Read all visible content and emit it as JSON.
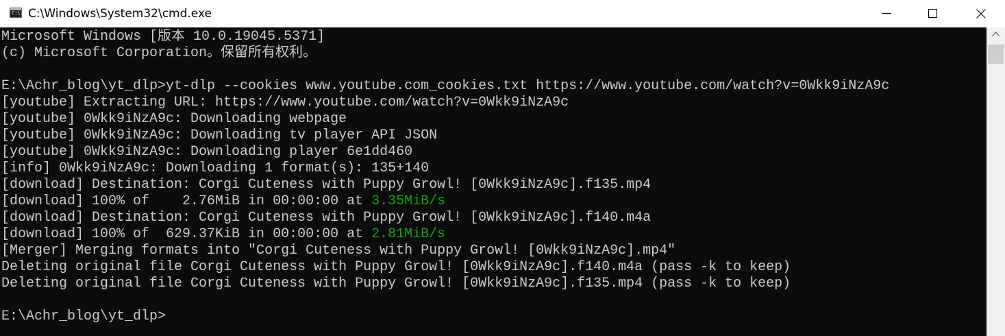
{
  "window": {
    "title": "C:\\Windows\\System32\\cmd.exe",
    "icon": "cmd-icon",
    "icon_glyph": "C:\\."
  },
  "controls": {
    "minimize": "minimize-icon",
    "maximize": "maximize-icon",
    "close": "close-icon"
  },
  "console": {
    "lines": [
      {
        "text": "Microsoft Windows [版本 10.0.19045.5371]"
      },
      {
        "text": "(c) Microsoft Corporation。保留所有权利。"
      },
      {
        "text": ""
      },
      {
        "text": "E:\\Achr_blog\\yt_dlp>yt-dlp --cookies www.youtube.com_cookies.txt https://www.youtube.com/watch?v=0Wkk9iNzA9c"
      },
      {
        "text": "[youtube] Extracting URL: https://www.youtube.com/watch?v=0Wkk9iNzA9c"
      },
      {
        "text": "[youtube] 0Wkk9iNzA9c: Downloading webpage"
      },
      {
        "text": "[youtube] 0Wkk9iNzA9c: Downloading tv player API JSON"
      },
      {
        "text": "[youtube] 0Wkk9iNzA9c: Downloading player 6e1dd460"
      },
      {
        "text": "[info] 0Wkk9iNzA9c: Downloading 1 format(s): 135+140"
      },
      {
        "text": "[download] Destination: Corgi Cuteness with Puppy Growl! [0Wkk9iNzA9c].f135.mp4"
      },
      {
        "text": "[download] 100% of    2.76MiB in 00:00:00 at ",
        "speed": "3.35MiB/s"
      },
      {
        "text": "[download] Destination: Corgi Cuteness with Puppy Growl! [0Wkk9iNzA9c].f140.m4a"
      },
      {
        "text": "[download] 100% of  629.37KiB in 00:00:00 at ",
        "speed": "2.81MiB/s"
      },
      {
        "text": "[Merger] Merging formats into \"Corgi Cuteness with Puppy Growl! [0Wkk9iNzA9c].mp4\""
      },
      {
        "text": "Deleting original file Corgi Cuteness with Puppy Growl! [0Wkk9iNzA9c].f140.m4a (pass -k to keep)"
      },
      {
        "text": "Deleting original file Corgi Cuteness with Puppy Growl! [0Wkk9iNzA9c].f135.mp4 (pass -k to keep)"
      },
      {
        "text": ""
      },
      {
        "text": "E:\\Achr_blog\\yt_dlp>"
      }
    ]
  },
  "colors": {
    "console_bg": "#0c0c0c",
    "console_fg": "#cccccc",
    "speed_green": "#13a10e"
  }
}
